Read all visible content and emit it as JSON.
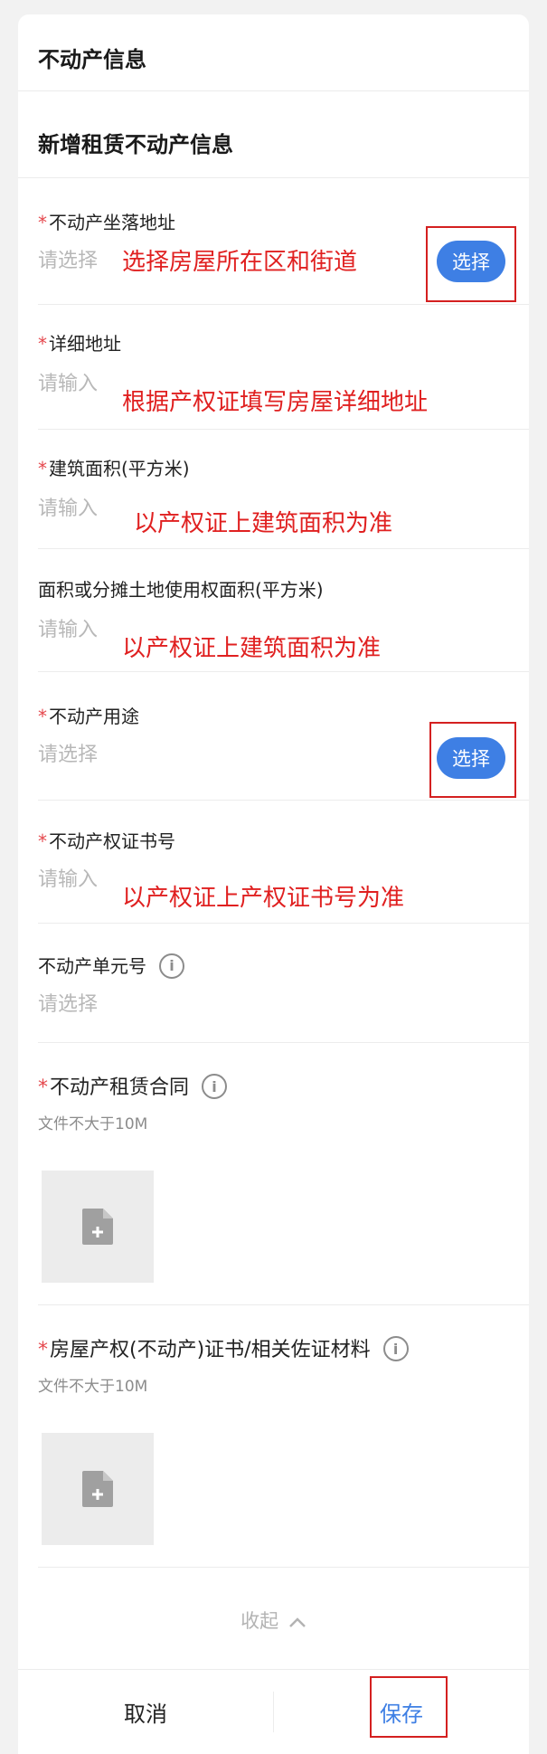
{
  "header": {
    "title": "不动产信息"
  },
  "subheader": {
    "title": "新增租赁不动产信息"
  },
  "fields": {
    "location": {
      "label": "不动产坐落地址",
      "placeholder": "请选择",
      "button": "选择",
      "annotation": "选择房屋所在区和街道"
    },
    "detail": {
      "label": "详细地址",
      "placeholder": "请输入",
      "annotation": "根据产权证填写房屋详细地址"
    },
    "area": {
      "label": "建筑面积(平方米)",
      "placeholder": "请输入",
      "annotation": "以产权证上建筑面积为准"
    },
    "land_area": {
      "label": "面积或分摊土地使用权面积(平方米)",
      "placeholder": "请输入",
      "annotation": "以产权证上建筑面积为准"
    },
    "usage": {
      "label": "不动产用途",
      "placeholder": "请选择",
      "button": "选择"
    },
    "cert_no": {
      "label": "不动产权证书号",
      "placeholder": "请输入",
      "annotation": "以产权证上产权证书号为准"
    },
    "unit_no": {
      "label": "不动产单元号",
      "placeholder": "请选择"
    },
    "contract": {
      "label": "不动产租赁合同",
      "hint": "文件不大于10M"
    },
    "certificate": {
      "label": "房屋产权(不动产)证书/相关佐证材料",
      "hint": "文件不大于10M"
    }
  },
  "required_mark": "*",
  "info_glyph": "i",
  "collapse": {
    "label": "收起",
    "icon": "chevron-up-icon"
  },
  "footer": {
    "cancel": "取消",
    "save": "保存"
  },
  "colors": {
    "primary": "#3e7fe4",
    "annotation": "#e02020",
    "required": "#e5484d"
  }
}
